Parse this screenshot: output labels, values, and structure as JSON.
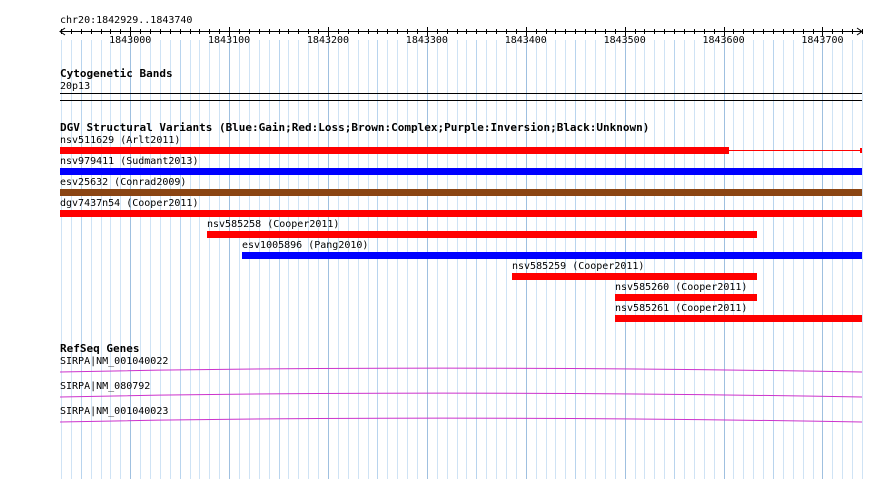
{
  "ruler": {
    "range_label": "chr20:1842929..1843740",
    "ticks": [
      {
        "label": "1843000",
        "pos": 1843000
      },
      {
        "label": "1843100",
        "pos": 1843100
      },
      {
        "label": "1843200",
        "pos": 1843200
      },
      {
        "label": "1843300",
        "pos": 1843300
      },
      {
        "label": "1843400",
        "pos": 1843400
      },
      {
        "label": "1843500",
        "pos": 1843500
      },
      {
        "label": "1843600",
        "pos": 1843600
      },
      {
        "label": "1843700",
        "pos": 1843700
      }
    ]
  },
  "cytoband": {
    "title": "Cytogenetic Bands",
    "band": "20p13"
  },
  "dgv": {
    "title": "DGV Structural Variants (Blue:Gain;Red:Loss;Brown:Complex;Purple:Inversion;Black:Unknown)",
    "colors": {
      "gain": "#0000ff",
      "loss": "#ff0000",
      "complex": "#8b4513",
      "inversion": "#800080",
      "unknown": "#000000"
    },
    "variants": [
      {
        "label": "nsv511629 (Arlt2011)",
        "start": 1842929,
        "end": 1843606,
        "color": "#ff0000",
        "thin_to": 1843740
      },
      {
        "label": "nsv979411 (Sudmant2013)",
        "start": 1842929,
        "end": 1843740,
        "color": "#0000ff"
      },
      {
        "label": "esv25632 (Conrad2009)",
        "start": 1842929,
        "end": 1843740,
        "color": "#8b4513"
      },
      {
        "label": "dgv7437n54 (Cooper2011)",
        "start": 1842929,
        "end": 1843740,
        "color": "#ff0000"
      },
      {
        "label": "nsv585258 (Cooper2011)",
        "start": 1843078,
        "end": 1843634,
        "color": "#ff0000"
      },
      {
        "label": "esv1005896 (Pang2010)",
        "start": 1843113,
        "end": 1843740,
        "color": "#0000ff"
      },
      {
        "label": "nsv585259 (Cooper2011)",
        "start": 1843386,
        "end": 1843634,
        "color": "#ff0000"
      },
      {
        "label": "nsv585260 (Cooper2011)",
        "start": 1843490,
        "end": 1843634,
        "color": "#ff0000"
      },
      {
        "label": "nsv585261 (Cooper2011)",
        "start": 1843490,
        "end": 1843740,
        "color": "#ff0000"
      }
    ]
  },
  "refseq": {
    "title": "RefSeq Genes",
    "color": "#cc33cc",
    "genes": [
      {
        "label": "SIRPA|NM_001040022"
      },
      {
        "label": "SIRPA|NM_080792"
      },
      {
        "label": "SIRPA|NM_001040023"
      }
    ]
  }
}
